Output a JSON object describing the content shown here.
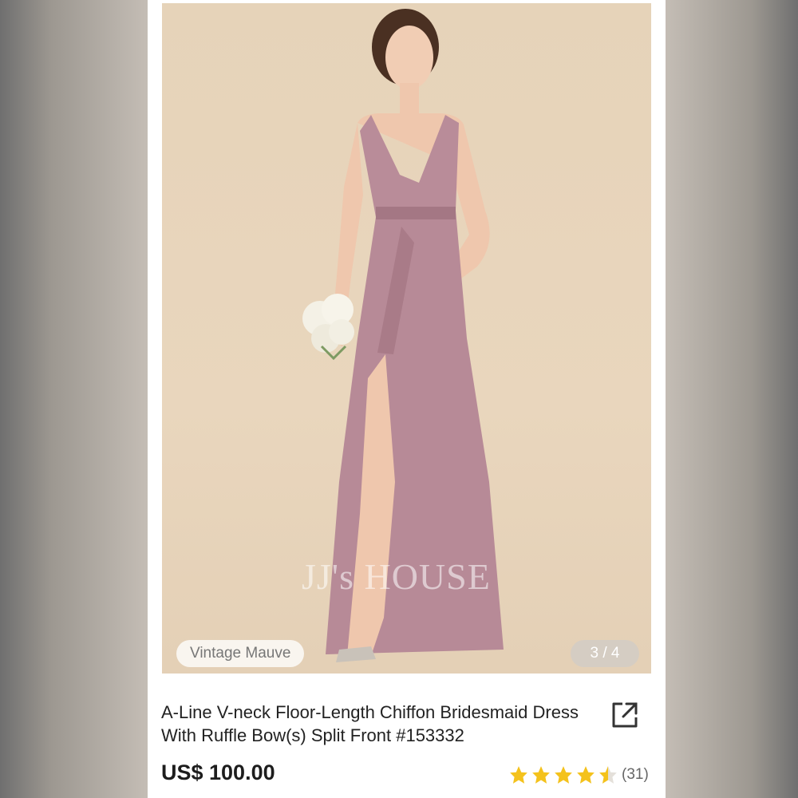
{
  "product": {
    "image_alt": "Model wearing mauve chiffon dress",
    "watermark": "JJ's HOUSE",
    "color_label": "Vintage Mauve",
    "image_counter": "3 / 4",
    "title": "A-Line V-neck Floor-Length Chiffon Bridesmaid Dress With Ruffle Bow(s) Split Front #153332",
    "price": "US$ 100.00",
    "rating": 4.5,
    "review_count": "(31)"
  },
  "icons": {
    "share": "share-icon",
    "star": "star-icon"
  },
  "colors": {
    "dress": "#b78a97",
    "background": "#e8d5bc",
    "star": "#f4c21c"
  }
}
